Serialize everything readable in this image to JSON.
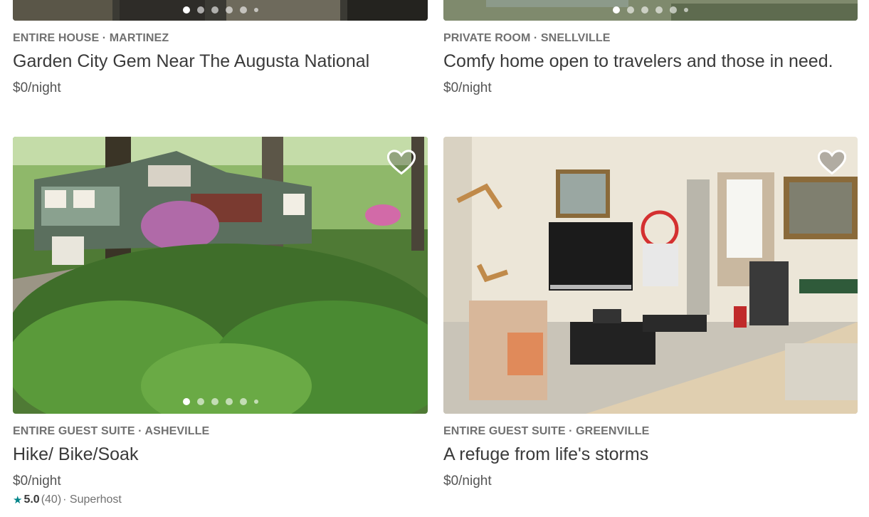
{
  "listings": [
    {
      "kicker": "ENTIRE HOUSE · MARTINEZ",
      "title": "Garden City Gem Near The Augusta National",
      "price": "$0/night",
      "photo": "house-exterior-photo"
    },
    {
      "kicker": "PRIVATE ROOM · SNELLVILLE",
      "title": "Comfy home open to travelers and those in need.",
      "price": "$0/night",
      "photo": "garden-photo"
    },
    {
      "kicker": "ENTIRE GUEST SUITE · ASHEVILLE",
      "title": "Hike/ Bike/Soak",
      "price": "$0/night",
      "photo": "forest-house-photo",
      "rating": {
        "score": "5.0",
        "count": "(40)",
        "badge": "· Superhost"
      }
    },
    {
      "kicker": "ENTIRE GUEST SUITE · GREENVILLE",
      "title": "A refuge from life's storms",
      "price": "$0/night",
      "photo": "living-room-photo"
    }
  ],
  "icons": {
    "favorite": "heart-outline-icon",
    "rating": "star-icon"
  },
  "colors": {
    "accent": "#008489",
    "text": "#484848",
    "muted": "#717171"
  }
}
